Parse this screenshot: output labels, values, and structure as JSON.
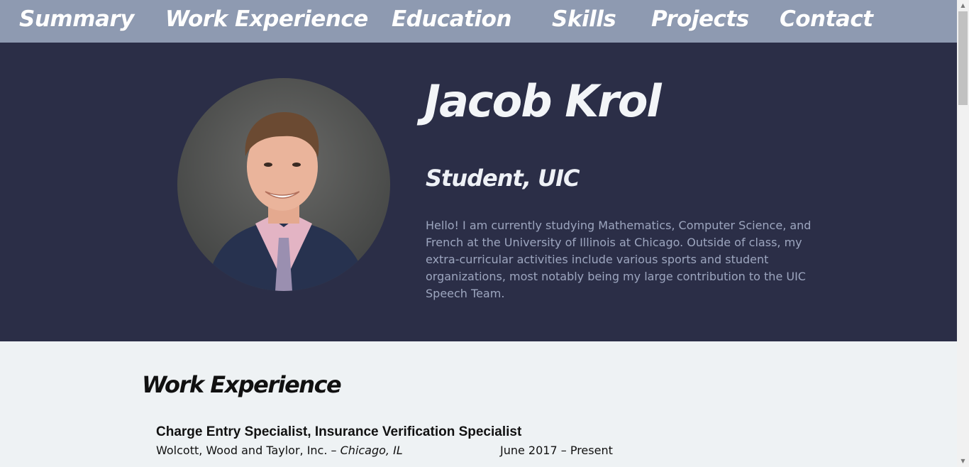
{
  "nav": {
    "items": [
      {
        "label": "Summary"
      },
      {
        "label": "Work Experience"
      },
      {
        "label": "Education"
      },
      {
        "label": "Skills"
      },
      {
        "label": "Projects"
      },
      {
        "label": "Contact"
      }
    ]
  },
  "hero": {
    "name": "Jacob Krol",
    "role": "Student, UIC",
    "bio": "Hello! I am currently studying Mathematics, Computer Science, and French at the University of Illinois at Chicago. Outside of class, my extra-curricular activities include various sports and student organizations, most notably being my large contribution to the UIC Speech Team."
  },
  "work": {
    "heading": "Work Experience",
    "jobs": [
      {
        "title": "Charge Entry Specialist, Insurance Verification Specialist",
        "company": "Wolcott, Wood and Taylor, Inc. –",
        "location": "Chicago, IL",
        "dates": "June 2017 – Present"
      }
    ]
  },
  "colors": {
    "nav_bg": "#8e9ab1",
    "hero_bg": "#2b2e47",
    "content_bg": "#eef2f4",
    "bio_text": "#9da6bf"
  },
  "icons": {
    "scroll_up": "up-arrow-icon",
    "scroll_down": "down-arrow-icon"
  }
}
